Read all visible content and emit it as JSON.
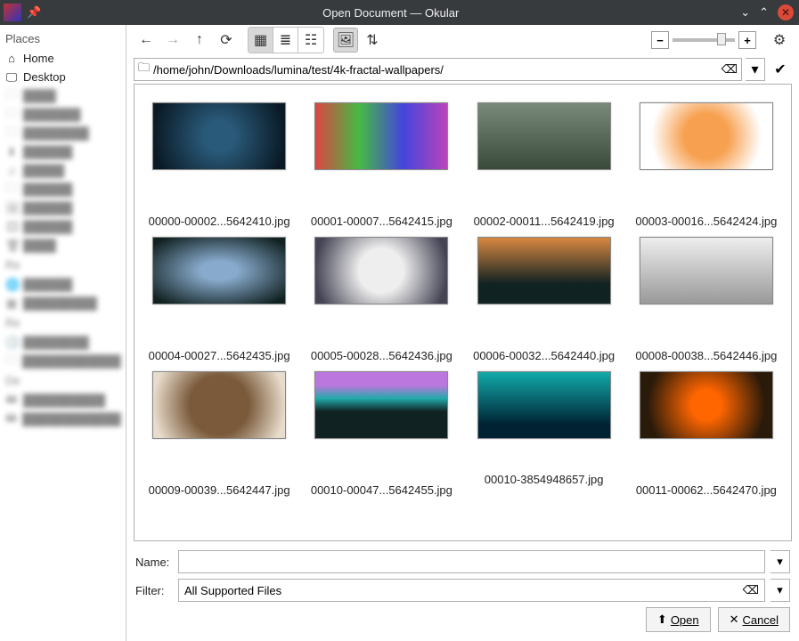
{
  "window": {
    "title": "Open Document — Okular"
  },
  "sidebar": {
    "places_heading": "Places",
    "home": "Home",
    "desktop": "Desktop",
    "remote_heading": "Re",
    "recent_heading": "Re",
    "devices_heading": "De"
  },
  "path": "/home/john/Downloads/lumina/test/4k-fractal-wallpapers/",
  "files": [
    "00000-00002...5642410.jpg",
    "00001-00007...5642415.jpg",
    "00002-00011...5642419.jpg",
    "00003-00016...5642424.jpg",
    "00004-00027...5642435.jpg",
    "00005-00028...5642436.jpg",
    "00006-00032...5642440.jpg",
    "00008-00038...5642446.jpg",
    "00009-00039...5642447.jpg",
    "00010-00047...5642455.jpg",
    "00010-3854948657.jpg",
    "00011-00062...5642470.jpg"
  ],
  "bottom": {
    "name_label": "Name:",
    "name_value": "",
    "filter_label": "Filter:",
    "filter_value": "All Supported Files",
    "open_label": "Open",
    "cancel_label": "Cancel"
  }
}
